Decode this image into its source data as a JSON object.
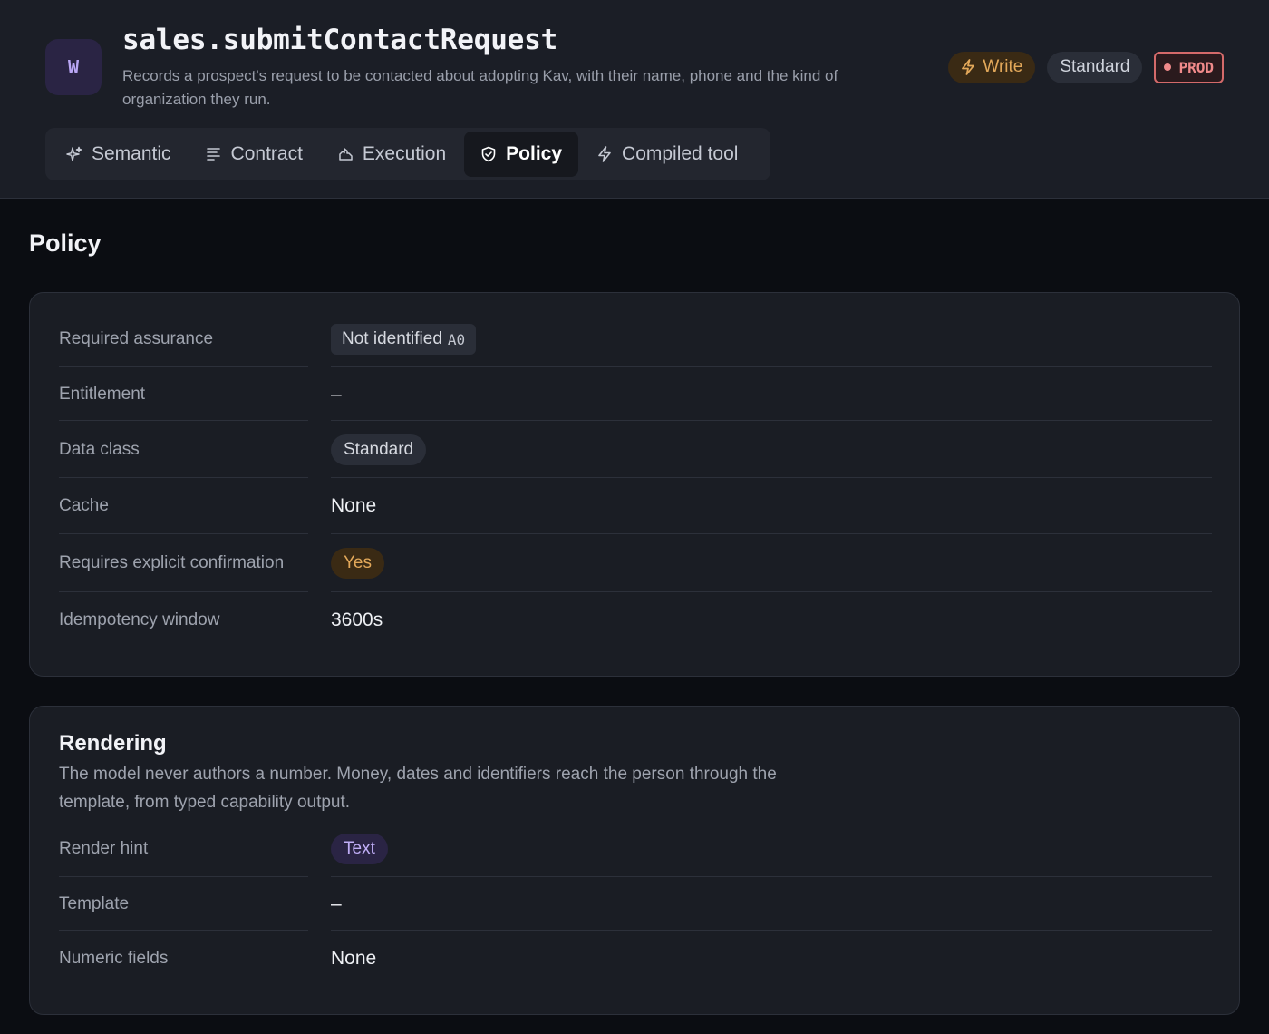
{
  "header": {
    "avatar_letter": "W",
    "title": "sales.submitContactRequest",
    "description": "Records a prospect's request to be contacted about adopting Kav, with their name, phone and the kind of organization they run.",
    "badges": {
      "write": "Write",
      "standard": "Standard",
      "prod": "PROD"
    }
  },
  "tabs": [
    {
      "label": "Semantic",
      "icon": "sparkle-icon",
      "active": false
    },
    {
      "label": "Contract",
      "icon": "lines-icon",
      "active": false
    },
    {
      "label": "Execution",
      "icon": "cloud-icon",
      "active": false
    },
    {
      "label": "Policy",
      "icon": "shield-icon",
      "active": true
    },
    {
      "label": "Compiled tool",
      "icon": "bolt-icon",
      "active": false
    }
  ],
  "policy": {
    "section_title": "Policy",
    "rows": {
      "required_assurance": {
        "label": "Required assurance",
        "value": "Not identified",
        "code": "A0"
      },
      "entitlement": {
        "label": "Entitlement",
        "value": "–"
      },
      "data_class": {
        "label": "Data class",
        "value": "Standard"
      },
      "cache": {
        "label": "Cache",
        "value": "None"
      },
      "confirmation": {
        "label": "Requires explicit confirmation",
        "value": "Yes"
      },
      "idempotency": {
        "label": "Idempotency window",
        "value": "3600s"
      }
    }
  },
  "rendering": {
    "title": "Rendering",
    "description": "The model never authors a number. Money, dates and identifiers reach the person through the template, from typed capability output.",
    "rows": {
      "render_hint": {
        "label": "Render hint",
        "value": "Text"
      },
      "template": {
        "label": "Template",
        "value": "–"
      },
      "numeric_fields": {
        "label": "Numeric fields",
        "value": "None"
      }
    }
  },
  "colors": {
    "accent_purple": "#b9a6f4",
    "write_amber": "#e2a85a",
    "prod_red": "#f08a8a"
  }
}
